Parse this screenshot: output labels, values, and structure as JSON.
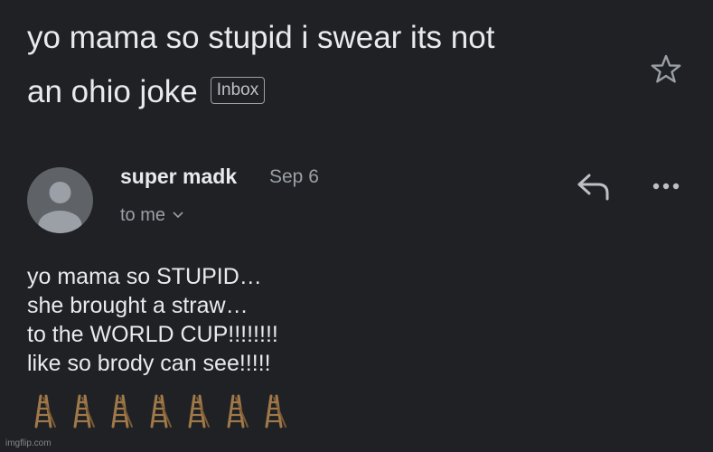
{
  "email": {
    "subject_line1": "yo mama so stupid i swear its not",
    "subject_line2": "an ohio joke",
    "label_badge": "Inbox",
    "sender_name": "super madk",
    "date": "Sep 6",
    "recipient_text": "to me",
    "body_lines": [
      "yo mama so STUPID…",
      "she brought a straw…",
      "to the WORLD CUP!!!!!!!!",
      "like so brody can see!!!!!"
    ],
    "emoji_icon": "ladder-emoji",
    "emoji_count": 7
  },
  "icons": {
    "star": "star-outline-icon",
    "reply": "reply-arrow-icon",
    "more": "more-horizontal-icon",
    "avatar": "default-person-avatar"
  },
  "watermark": "imgflip.com",
  "colors": {
    "background": "#202124",
    "primary_text": "#e8eaed",
    "secondary_text": "#9aa0a6",
    "avatar_bg": "#5f6368",
    "avatar_fg": "#9aa0a6",
    "ladder": "#a0794a"
  }
}
